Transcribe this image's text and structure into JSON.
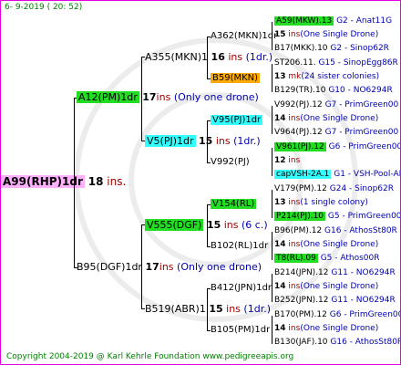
{
  "header": "6-  9-2019 ( 20: 52)",
  "copyright": "Copyright 2004-2019 @ Karl Kehrle Foundation    www.pedigreeapis.org",
  "colors": {
    "magenta": "#ffb0ff",
    "green": "#22dd22",
    "cyan": "#33ffff",
    "orange": "#ffaa00",
    "border": "#e000e0"
  },
  "root": {
    "name": "A99(RHP)1dr",
    "ins_num": "18",
    "ins_word": "ins."
  },
  "gen1": [
    {
      "name": "A12(PM)1dr",
      "ins_num": "17",
      "ins_word": "ins",
      "note": "(Only one drone)"
    },
    {
      "name": "B95(DGF)1dr",
      "ins_num": "17",
      "ins_word": "ins",
      "note": "(Only one drone)"
    }
  ],
  "gen2": [
    {
      "name": "A355(MKN)1",
      "ins_num": "16",
      "ins_word": "ins",
      "note": "(1dr.)"
    },
    {
      "name": "V5(PJ)1dr",
      "ins_num": "15",
      "ins_word": "ins",
      "note": "(1dr.)"
    },
    {
      "name": "V555(DGF)",
      "ins_num": "15",
      "ins_word": "ins",
      "note": "(6 c.)"
    },
    {
      "name": "B519(ABR)1",
      "ins_num": "15",
      "ins_word": "ins",
      "note": "(1dr.)"
    }
  ],
  "gen3": [
    {
      "name": "A362(MKN)1dr",
      "ins_num": "15",
      "ins_word": "ins",
      "note": "(One Single Drone)"
    },
    {
      "name": "B59(MKN)",
      "ins_num": "13",
      "ins_word": "mk",
      "note": "(24 sister colonies)"
    },
    {
      "name": "V95(PJ)1dr",
      "ins_num": "14",
      "ins_word": "ins",
      "note": "(One Single Drone)"
    },
    {
      "name": "V992(PJ)",
      "ins_num": "12",
      "ins_word": "ins",
      "note": ""
    },
    {
      "name": "V154(RL)",
      "ins_num": "13",
      "ins_word": "ins",
      "note": "(1 single colony)"
    },
    {
      "name": "B102(RL)1dr",
      "ins_num": "14",
      "ins_word": "ins",
      "note": "(One Single Drone)"
    },
    {
      "name": "B412(JPN)1dr",
      "ins_num": "14",
      "ins_word": "ins",
      "note": "(One Single Drone)"
    },
    {
      "name": "B105(PM)1dr",
      "ins_num": "14",
      "ins_word": "ins",
      "note": "(One Single Drone)"
    }
  ],
  "gen4": [
    {
      "name": "A59(MKW).13",
      "ref": "G2 - Anat11G"
    },
    {
      "name": "B17(MKK).10",
      "ref": "G2 - Sinop62R"
    },
    {
      "name": "ST206.11.",
      "ref": "G15 - SinopEgg86R"
    },
    {
      "name": "B129(TR).10",
      "ref": "G10 - NO6294R"
    },
    {
      "name": "V992(PJ).12",
      "ref": "G7 - PrimGreen00"
    },
    {
      "name": "V964(PJ).12",
      "ref": "G7 - PrimGreen00"
    },
    {
      "name": "V961(PJ).12",
      "ref": "G6 - PrimGreen00"
    },
    {
      "name": "capVSH-2A.1",
      "ref": "G1 - VSH-Pool-AR"
    },
    {
      "name": "V179(PM).12",
      "ref": "G24 - Sinop62R"
    },
    {
      "name": "P214(PJ).10",
      "ref": "G5 - PrimGreen00"
    },
    {
      "name": "B96(PM).12",
      "ref": "G16 - AthosSt80R"
    },
    {
      "name": "T8(RL).09",
      "ref": "G5 - Athos00R"
    },
    {
      "name": "B214(JPN).12",
      "ref": "G11 - NO6294R"
    },
    {
      "name": "B252(JPN).12",
      "ref": "G11 - NO6294R"
    },
    {
      "name": "B170(PM).12",
      "ref": "G6 - PrimGreen00"
    },
    {
      "name": "B130(JAF).10",
      "ref": "G16 - AthosSt80R"
    }
  ]
}
